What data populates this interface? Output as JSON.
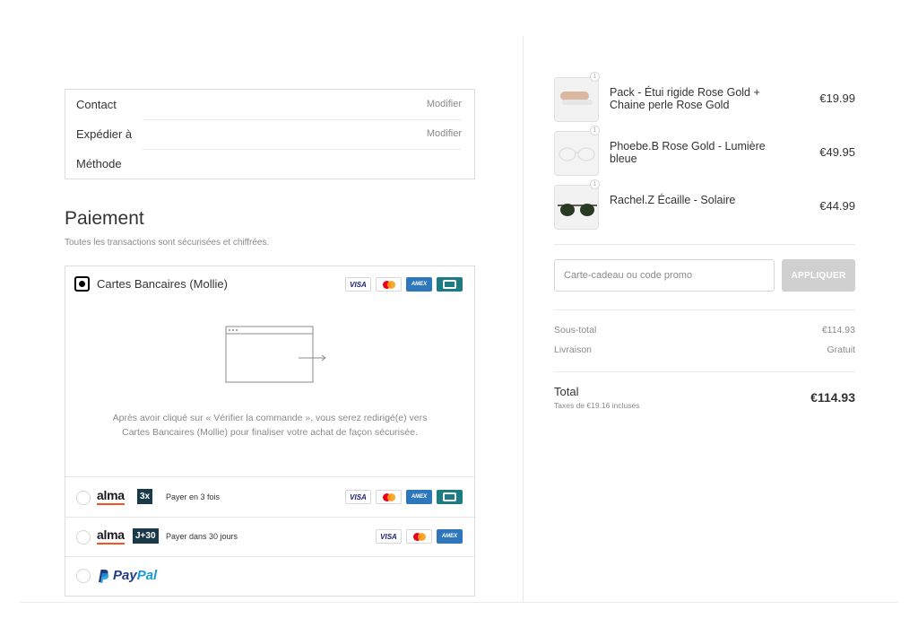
{
  "review": {
    "contact_label": "Contact",
    "contact_link": "Modifier",
    "ship_label": "Expédier à",
    "ship_link": "Modifier",
    "method_label": "Méthode"
  },
  "payment": {
    "title": "Paiement",
    "subtitle": "Toutes les transactions sont sécurisées et chiffrées.",
    "mollie_label": "Cartes Bancaires (Mollie)",
    "redirect_text": "Après avoir cliqué sur « Vérifier la commande », vous serez redirigé(e) vers Cartes Bancaires (Mollie) pour finaliser votre achat de façon sécurisée.",
    "alma3x_logo": "alma",
    "alma3x_badge": "3x",
    "alma3x_desc": "Payer en 3 fois",
    "alma30_logo": "alma",
    "alma30_badge": "J+30",
    "alma30_desc": "Payer dans 30 jours",
    "paypal_a": "Pay",
    "paypal_b": "Pal",
    "card_visa": "VISA",
    "card_amex": "AMEX"
  },
  "cart": {
    "items": [
      {
        "name": "Pack - Étui rigide Rose Gold + Chaine perle Rose Gold",
        "price": "€19.99",
        "qty": "1"
      },
      {
        "name": "Phoebe.B Rose Gold - Lumière bleue",
        "price": "€49.95",
        "qty": "1"
      },
      {
        "name": "Rachel.Z Écaille - Solaire",
        "price": "€44.99",
        "qty": "1"
      }
    ],
    "promo_placeholder": "Carte-cadeau ou code promo",
    "apply_label": "APPLIQUER",
    "subtotal_label": "Sous-total",
    "subtotal_value": "€114.93",
    "shipping_label": "Livraison",
    "shipping_value": "Gratuit",
    "total_label": "Total",
    "tax_note": "Taxes de €19.16 incluses",
    "total_value": "€114.93"
  },
  "colors": {
    "alma_orange": "#fa5022",
    "paypal_dark": "#253b80",
    "paypal_light": "#179bd7",
    "amex_blue": "#2e77bc",
    "cb_teal": "#1d7b84"
  }
}
